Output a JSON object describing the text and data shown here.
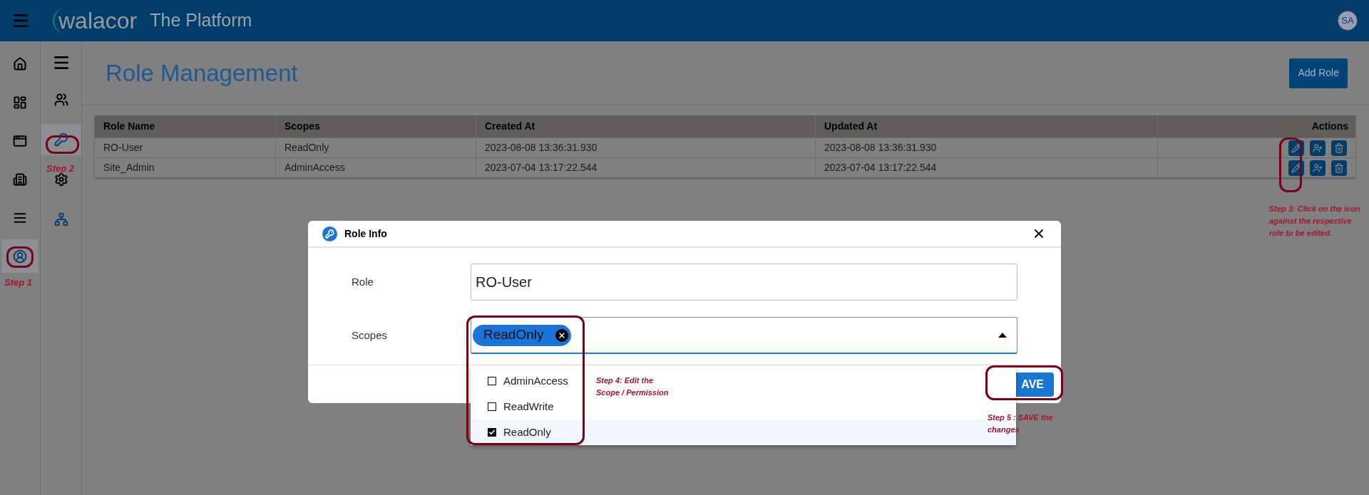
{
  "header": {
    "logo_text": "walacor",
    "title": "The Platform",
    "avatar": "SA"
  },
  "nav_rail": [
    {
      "kind": "home",
      "selected": false
    },
    {
      "kind": "dashboard",
      "selected": false
    },
    {
      "kind": "window",
      "selected": false
    },
    {
      "kind": "building",
      "selected": false
    },
    {
      "kind": "list",
      "selected": false
    },
    {
      "kind": "people-circle",
      "selected": true
    }
  ],
  "sub_rail": [
    {
      "kind": "users",
      "selected": false
    },
    {
      "kind": "key",
      "selected": true
    },
    {
      "kind": "settings",
      "selected": false
    },
    {
      "kind": "network",
      "selected": false
    }
  ],
  "page": {
    "title": "Role Management",
    "add_button": "Add Role"
  },
  "table": {
    "columns": [
      "Role Name",
      "Scopes",
      "Created At",
      "Updated At",
      "Actions"
    ],
    "rows": [
      {
        "cells": [
          "RO-User",
          "ReadOnly",
          "2023-08-08 13:36:31.930",
          "2023-08-08 13:36:31.930"
        ]
      },
      {
        "cells": [
          "Site_Admin",
          "AdminAccess",
          "2023-07-04 13:17:22.544",
          "2023-07-04 13:17:22.544"
        ]
      }
    ]
  },
  "dialog": {
    "title": "Role Info",
    "fields": [
      {
        "kind": "text",
        "label": "Role",
        "value": "RO-User"
      },
      {
        "kind": "multiselect",
        "label": "Scopes",
        "chips": [
          "ReadOnly"
        ],
        "expanded": true,
        "options": [
          {
            "label": "AdminAccess",
            "checked": false,
            "selected": false
          },
          {
            "label": "ReadWrite",
            "checked": false,
            "selected": false
          },
          {
            "label": "ReadOnly",
            "checked": true,
            "selected": true
          }
        ]
      }
    ],
    "save_button": "AVE"
  },
  "annotations": {
    "step_1": "Step 1",
    "step_2": "Step 2",
    "step_3": "Step 3: Click on the icon against the respective role to be edited.",
    "step_4": "Step 4: Edit the Scope / Permission",
    "step_5": "Step 5 : SAVE the changes"
  }
}
